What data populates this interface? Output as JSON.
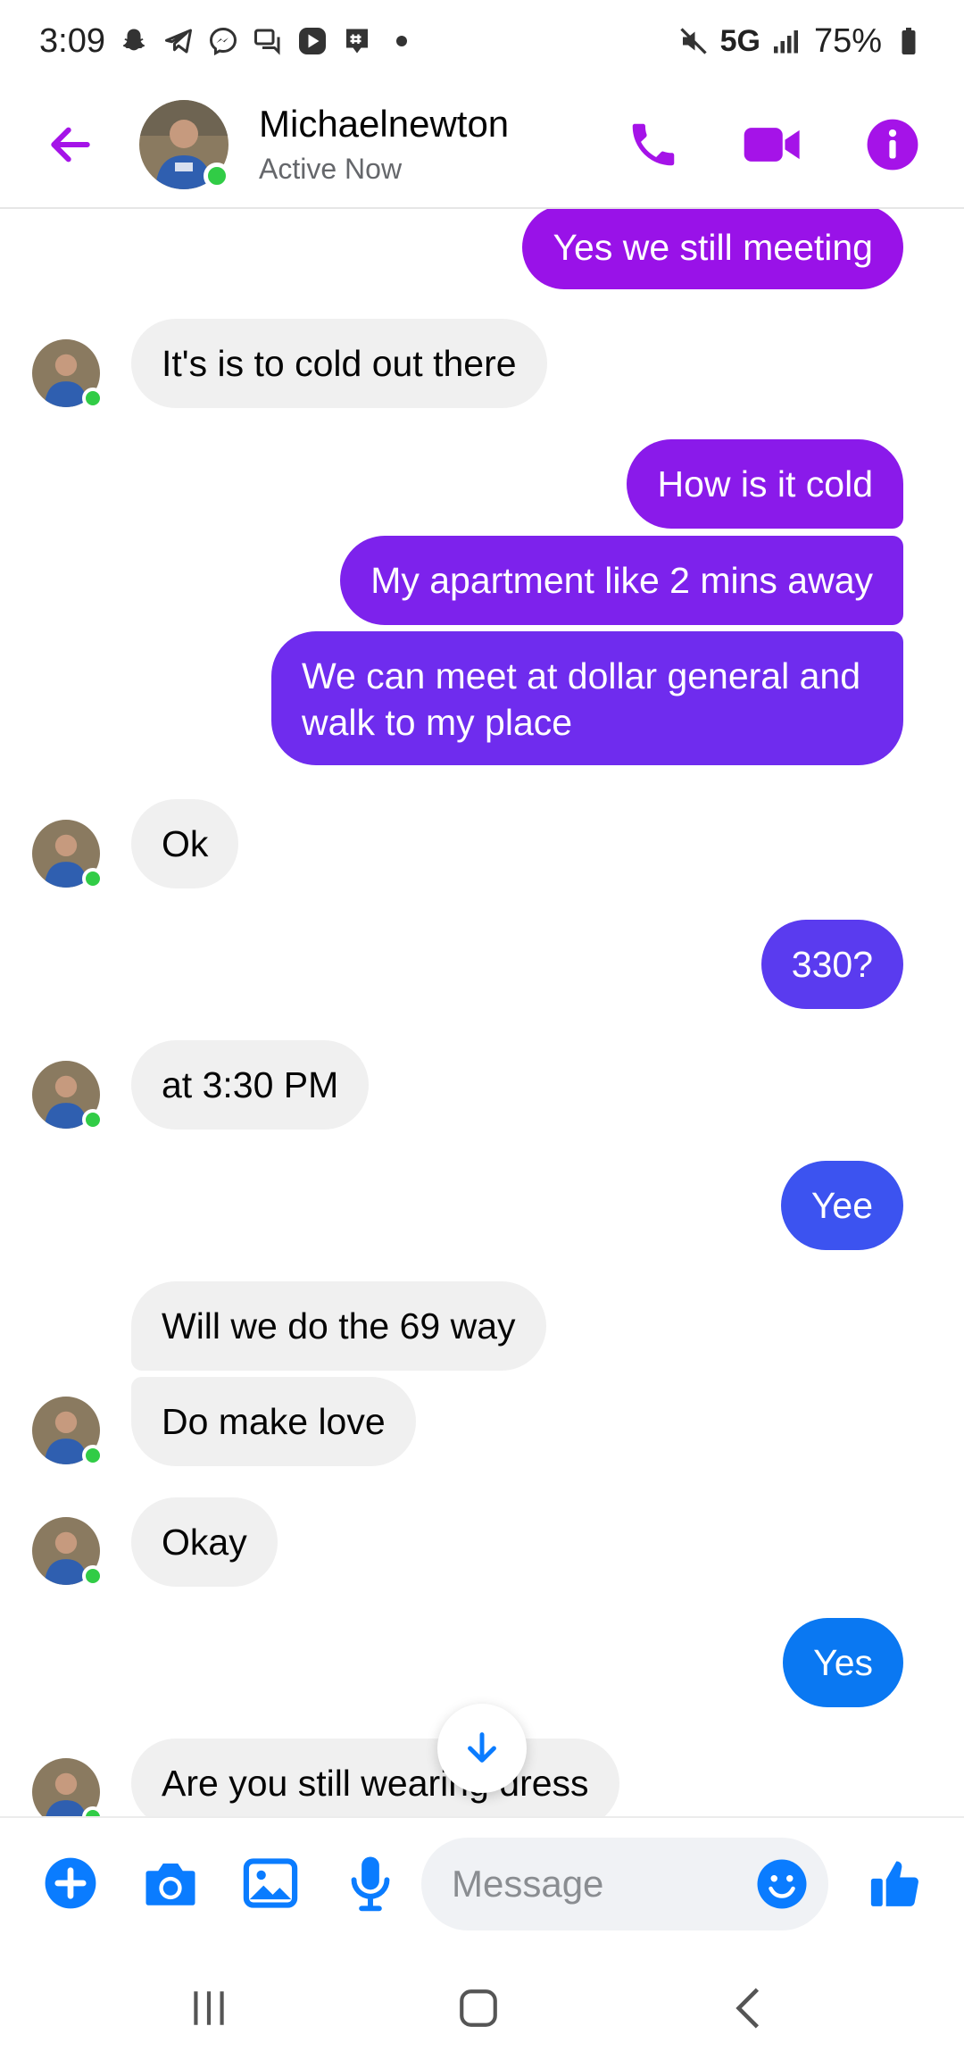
{
  "status_bar": {
    "time": "3:09",
    "network": "5G",
    "battery": "75%"
  },
  "header": {
    "contact_name": "Michaelnewton",
    "contact_status": "Active Now"
  },
  "messages": [
    {
      "from": "me",
      "text": "Yes we still meeting",
      "color": "#9912e8"
    },
    {
      "from": "them",
      "text": "It's is to cold out there"
    },
    {
      "from": "me",
      "text": "How is it cold",
      "color": "#8a1aea"
    },
    {
      "from": "me",
      "text": "My apartment like 2 mins away",
      "color": "#7d22ec"
    },
    {
      "from": "me",
      "text": "We can meet at dollar general and walk to my place",
      "color": "#6f2cee"
    },
    {
      "from": "them",
      "text": "Ok"
    },
    {
      "from": "me",
      "text": "330?",
      "color": "#5a3bef"
    },
    {
      "from": "them",
      "text": "at 3:30 PM"
    },
    {
      "from": "me",
      "text": "Yee",
      "color": "#3c53f0"
    },
    {
      "from": "them",
      "text": "Will we do the 69 way"
    },
    {
      "from": "them",
      "text": "Do make love"
    },
    {
      "from": "them",
      "text": "Okay"
    },
    {
      "from": "me",
      "text": "Yes",
      "color": "#0a78f2"
    },
    {
      "from": "them",
      "text": "Are you still wearing dress"
    }
  ],
  "composer": {
    "placeholder": "Message"
  },
  "icons": {
    "back": "arrow-left-icon",
    "call": "phone-icon",
    "video": "video-camera-icon",
    "info": "info-icon",
    "add": "plus-circle-icon",
    "camera": "camera-icon",
    "gallery": "image-icon",
    "voice": "microphone-icon",
    "emoji": "smiley-icon",
    "like": "thumbs-up-icon",
    "scroll": "arrow-down-icon"
  },
  "colors": {
    "accent": "#a513e8",
    "like_blue": "#0a7cff",
    "online": "#31cc46"
  }
}
